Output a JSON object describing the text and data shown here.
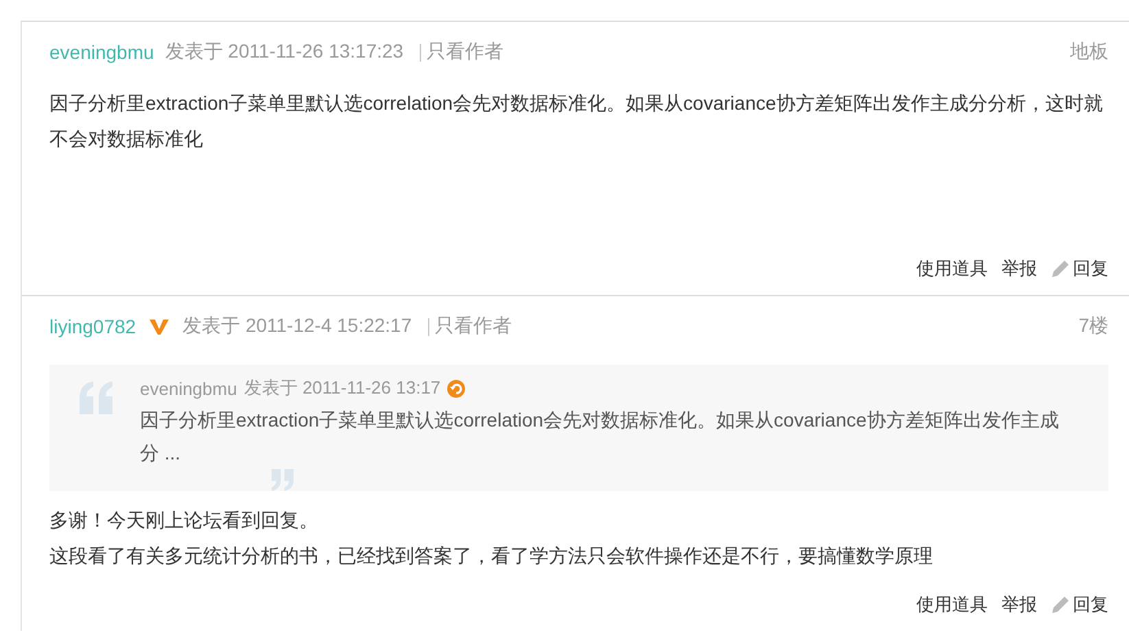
{
  "posts": [
    {
      "author": "eveningbmu",
      "vip": false,
      "posted_at": "发表于 2011-11-26 13:17:23",
      "author_only": "只看作者",
      "floor": "地板",
      "paragraphs": [
        "因子分析里extraction子菜单里默认选correlation会先对数据标准化。如果从covariance协方差矩阵出发作主成分分析，这时就不会对数据标准化"
      ],
      "actions": [
        "使用道具",
        "举报",
        "回复"
      ]
    },
    {
      "author": "liying0782",
      "vip": true,
      "posted_at": "发表于 2011-12-4 15:22:17",
      "author_only": "只看作者",
      "floor": "7楼",
      "quote": {
        "author": "eveningbmu",
        "posted_at": "发表于 2011-11-26 13:17",
        "text": "因子分析里extraction子菜单里默认选correlation会先对数据标准化。如果从covariance协方差矩阵出发作主成分 ..."
      },
      "paragraphs": [
        "多谢！今天刚上论坛看到回复。",
        "这段看了有关多元统计分析的书，已经找到答案了，看了学方法只会软件操作还是不行，要搞懂数学原理"
      ],
      "actions": [
        "使用道具",
        "举报",
        "回复"
      ]
    }
  ]
}
